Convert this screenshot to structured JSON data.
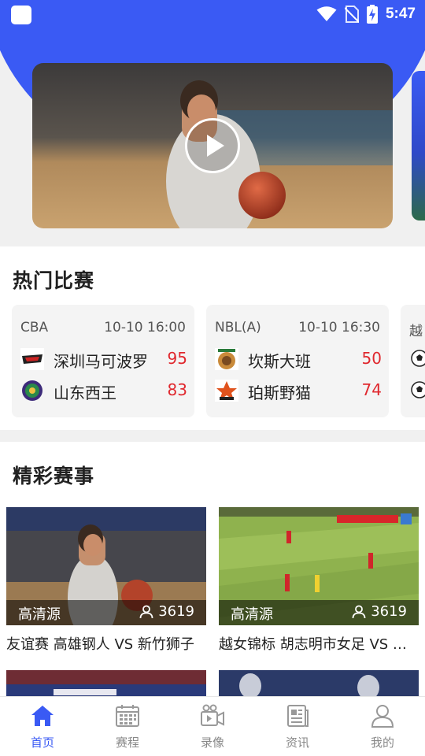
{
  "status_bar": {
    "time": "5:47",
    "icons": [
      "app-icon",
      "wifi-icon",
      "no-sim-icon",
      "battery-charging-icon"
    ]
  },
  "banner": {
    "play_icon": "play-icon"
  },
  "hot_matches": {
    "title": "热门比赛",
    "cards": [
      {
        "league": "CBA",
        "time": "10-10 16:00",
        "teams": [
          {
            "name": "深圳马可波罗",
            "score": "95"
          },
          {
            "name": "山东西王",
            "score": "83"
          }
        ]
      },
      {
        "league": "NBL(A)",
        "time": "10-10 16:30",
        "teams": [
          {
            "name": "坎斯大班",
            "score": "50"
          },
          {
            "name": "珀斯野猫",
            "score": "74"
          }
        ]
      },
      {
        "league": "越",
        "time": "",
        "teams": [
          {
            "name": "",
            "score": ""
          },
          {
            "name": "",
            "score": ""
          }
        ]
      }
    ]
  },
  "featured_events": {
    "title": "精彩赛事",
    "cards": [
      {
        "source": "高清源",
        "views": "3619",
        "title": "友谊赛 高雄钢人 VS 新竹狮子"
      },
      {
        "source": "高清源",
        "views": "3619",
        "title": "越女锦标 胡志明市女足 VS 胡志明市女足II"
      }
    ]
  },
  "tabbar": {
    "items": [
      {
        "label": "首页",
        "icon": "home-icon",
        "active": true
      },
      {
        "label": "赛程",
        "icon": "calendar-icon",
        "active": false
      },
      {
        "label": "录像",
        "icon": "video-icon",
        "active": false
      },
      {
        "label": "资讯",
        "icon": "news-icon",
        "active": false
      },
      {
        "label": "我的",
        "icon": "user-icon",
        "active": false
      }
    ]
  },
  "colors": {
    "brand_blue": "#3a5af4",
    "score_red": "#e0282e",
    "tab_inactive": "#888888"
  }
}
